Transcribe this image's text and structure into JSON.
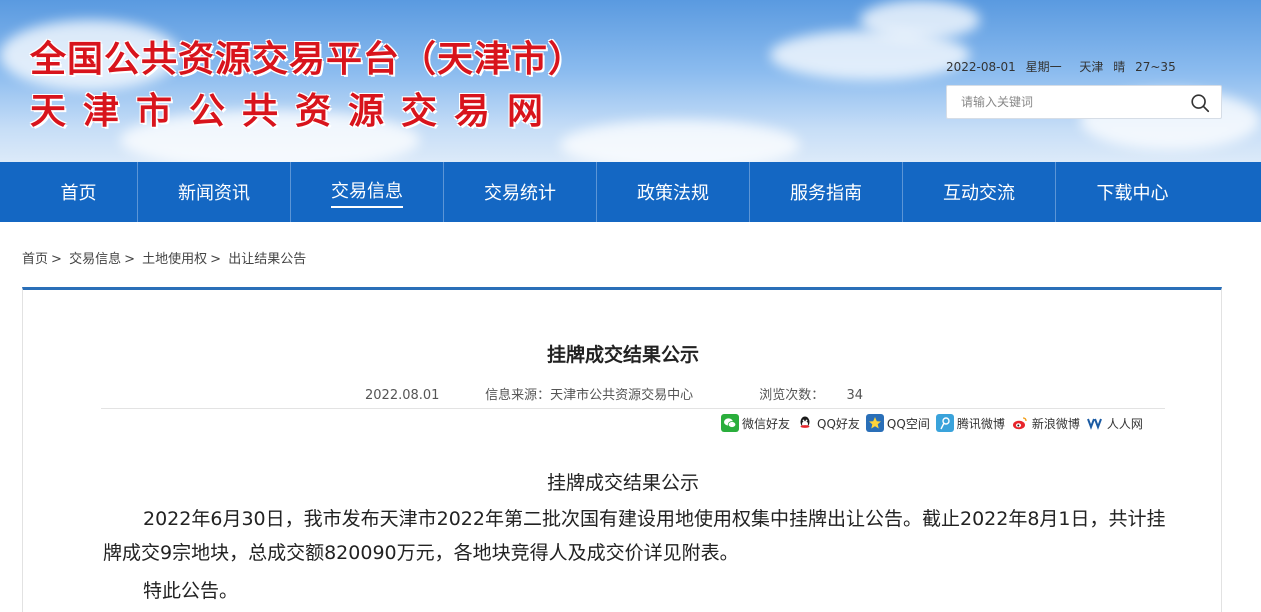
{
  "header": {
    "title_line1": "全国公共资源交易平台（天津市）",
    "title_line2": "天津市公共资源交易网",
    "date": "2022-08-01",
    "weekday": "星期一",
    "city": "天津",
    "weather": "晴",
    "temperature": "27~35",
    "search_placeholder": "请输入关键词"
  },
  "nav": {
    "items": [
      "首页",
      "新闻资讯",
      "交易信息",
      "交易统计",
      "政策法规",
      "服务指南",
      "互动交流",
      "下载中心"
    ],
    "active_index": 2
  },
  "breadcrumb": [
    "首页",
    "交易信息",
    "土地使用权",
    "出让结果公告"
  ],
  "article": {
    "title": "挂牌成交结果公示",
    "date": "2022.08.01",
    "source": "信息来源：天津市公共资源交易中心",
    "views_label": "浏览次数：",
    "views": "34",
    "share": [
      {
        "label": "微信好友",
        "icon": "wechat-icon",
        "color": "#2aae3c"
      },
      {
        "label": "QQ好友",
        "icon": "qq-icon",
        "color": "#1a1a1a"
      },
      {
        "label": "QQ空间",
        "icon": "qzone-icon",
        "color": "#2a6fb8"
      },
      {
        "label": "腾讯微博",
        "icon": "tencent-weibo-icon",
        "color": "#3aa3db"
      },
      {
        "label": "新浪微博",
        "icon": "sina-weibo-icon",
        "color": "#e8262c"
      },
      {
        "label": "人人网",
        "icon": "renren-icon",
        "color": "#1b5ba3"
      }
    ],
    "body_title": "挂牌成交结果公示",
    "paragraph1": "2022年6月30日，我市发布天津市2022年第二批次国有建设用地使用权集中挂牌出让公告。截止2022年8月1日，共计挂牌成交9宗地块，总成交额820090万元，各地块竞得人及成交价详见附表。",
    "paragraph2": "特此公告。"
  },
  "colors": {
    "nav_bg": "#1467c3",
    "title_red": "#d8141c",
    "article_border": "#2a6fb8"
  }
}
